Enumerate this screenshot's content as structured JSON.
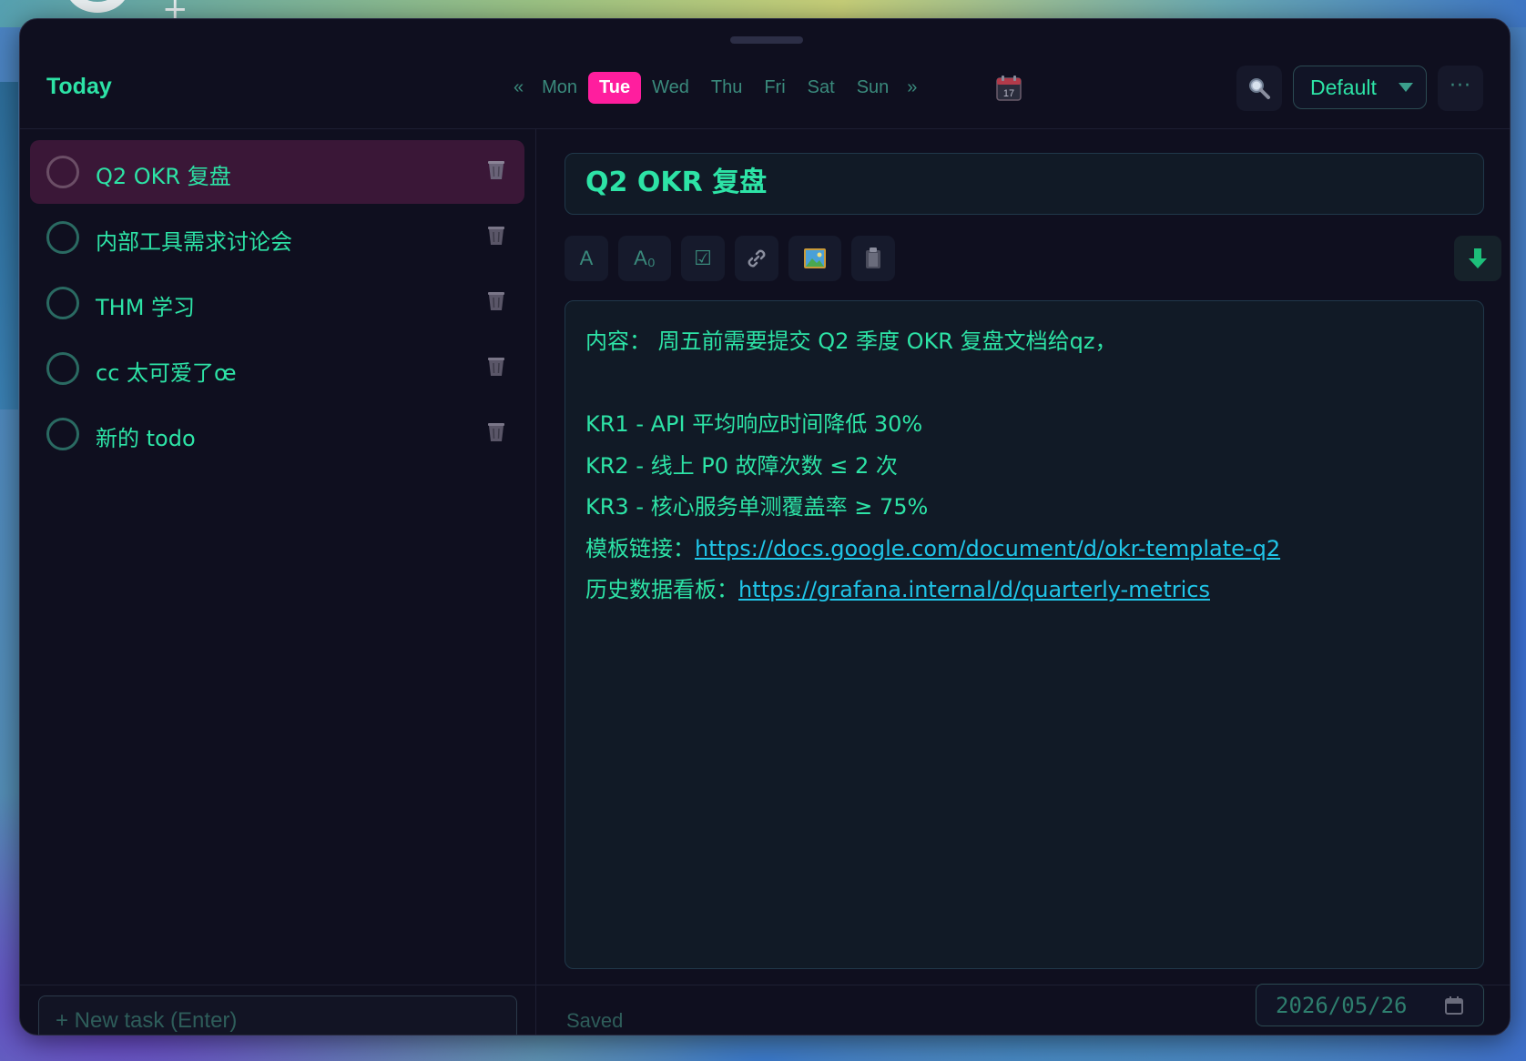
{
  "header": {
    "title": "Today",
    "nav_prev": "«",
    "nav_next": "»",
    "days": [
      {
        "label": "Mon",
        "active": false
      },
      {
        "label": "Tue",
        "active": true
      },
      {
        "label": "Wed",
        "active": false
      },
      {
        "label": "Thu",
        "active": false
      },
      {
        "label": "Fri",
        "active": false
      },
      {
        "label": "Sat",
        "active": false
      },
      {
        "label": "Sun",
        "active": false
      }
    ],
    "calendar_day": "17",
    "profile": "Default",
    "more": "···"
  },
  "tasks": [
    {
      "title": "Q2 OKR 复盘",
      "selected": true
    },
    {
      "title": "内部工具需求讨论会",
      "selected": false
    },
    {
      "title": "THM 学习",
      "selected": false
    },
    {
      "title": "cc 太可爱了œ",
      "selected": false
    },
    {
      "title": "新的 todo",
      "selected": false
    }
  ],
  "new_task": {
    "placeholder": "+ New task (Enter)"
  },
  "editor": {
    "title": "Q2 OKR 复盘",
    "toolbar": {
      "font": "A",
      "font_size": "A₀",
      "checkbox": "☑"
    },
    "content": {
      "line1": "内容： 周五前需要提交 Q2 季度 OKR 复盘文档给qz，",
      "line2": "KR1 - API 平均响应时间降低 30%",
      "line3": "KR2 - 线上 P0 故障次数 ≤ 2 次",
      "line4": "KR3 - 核心服务单测覆盖率 ≥ 75%",
      "line5_label": "模板链接：",
      "line5_link": "https://docs.google.com/document/d/okr-template-q2 ",
      "line6_label": "历史数据看板：",
      "line6_link": "https://grafana.internal/d/quarterly-metrics"
    }
  },
  "footer": {
    "status": "Saved",
    "date": "2026/05/26"
  },
  "colors": {
    "accent": "#2de3a6",
    "active_day": "#ff1e9e",
    "link": "#20c5e8",
    "background": "#0f0f1f",
    "selected_task": "#3a1737"
  },
  "icons": {
    "search": "magnifier-icon",
    "calendar": "calendar-icon",
    "delete": "trash-icon",
    "link": "link-icon",
    "image": "image-icon",
    "clipboard": "clipboard-icon",
    "save": "download-arrow-icon"
  }
}
